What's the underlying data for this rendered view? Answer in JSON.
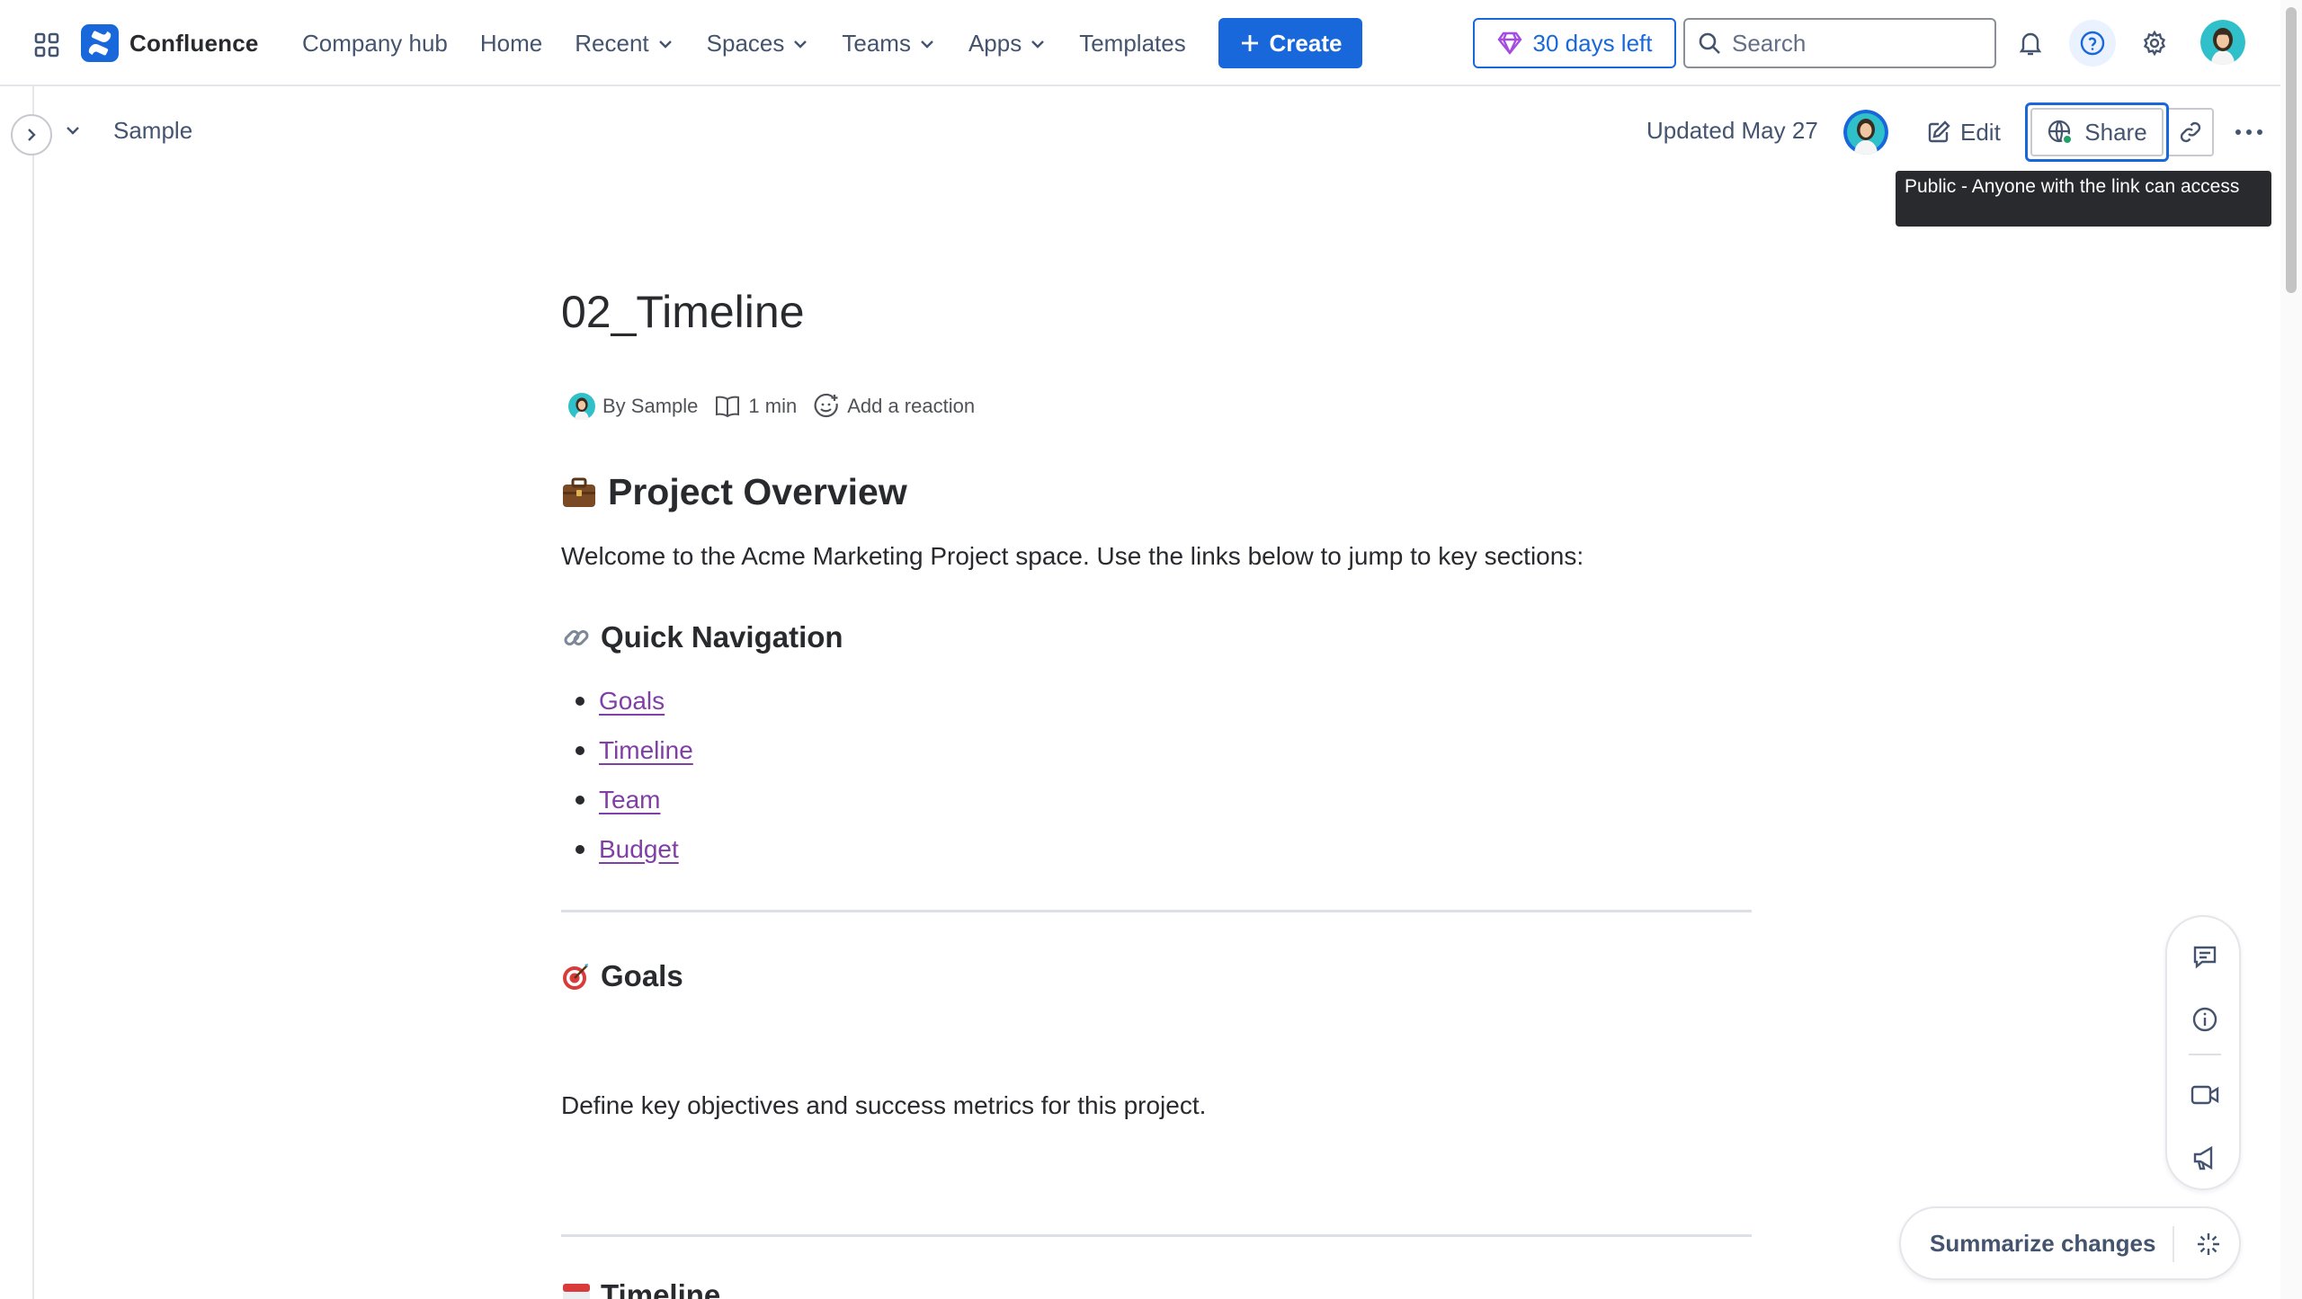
{
  "topnav": {
    "brand": "Confluence",
    "links": [
      {
        "label": "Company hub",
        "dropdown": false
      },
      {
        "label": "Home",
        "dropdown": false
      },
      {
        "label": "Recent",
        "dropdown": true
      },
      {
        "label": "Spaces",
        "dropdown": true
      },
      {
        "label": "Teams",
        "dropdown": true
      },
      {
        "label": "Apps",
        "dropdown": true
      },
      {
        "label": "Templates",
        "dropdown": false
      }
    ],
    "create_label": "Create",
    "trial_label": "30 days left",
    "search_placeholder": "Search"
  },
  "page_header": {
    "breadcrumb": "Sample",
    "updated": "Updated May 27",
    "edit_label": "Edit",
    "share_label": "Share",
    "share_tooltip": "Public - Anyone with the link can access"
  },
  "page": {
    "title": "02_Timeline",
    "byline_author": "By Sample",
    "byline_read_time": "1 min",
    "byline_reaction": "Add a reaction",
    "overview_heading": "Project Overview",
    "welcome_text": "Welcome to the Acme Marketing Project space. Use the links below to jump to key sections:",
    "quick_nav_heading": "Quick Navigation",
    "quick_nav_links": [
      "Goals",
      "Timeline",
      "Team",
      "Budget"
    ],
    "goals_heading": "Goals",
    "goals_text": "Define key objectives and success metrics for this project.",
    "timeline_heading": "Timeline"
  },
  "floating": {
    "summarize_label": "Summarize changes"
  },
  "colors": {
    "brand_blue": "#1868db",
    "link_purple": "#803fa5",
    "text": "#292a2e",
    "subtle_text": "#44546f",
    "tooltip_bg": "#292a2e"
  }
}
